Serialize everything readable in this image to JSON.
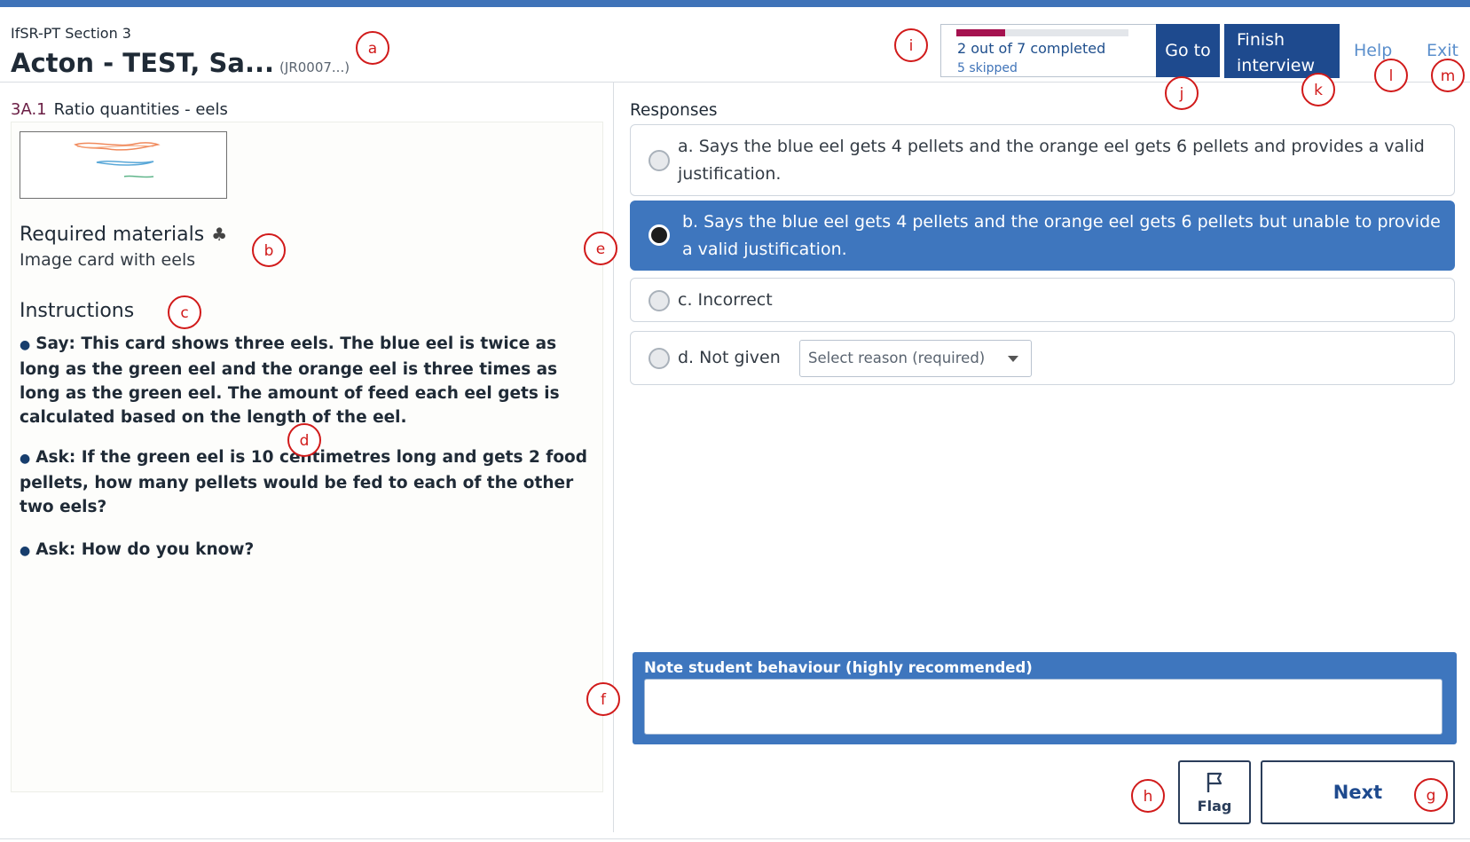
{
  "header": {
    "section_title": "IfSR-PT Section 3",
    "student_name": "Acton - TEST, Sa...",
    "student_id": "(JR0007...)"
  },
  "progress": {
    "completed_text": "2 out of 7 completed",
    "skipped_text": "5 skipped",
    "completed": 2,
    "total": 7,
    "fill_color": "#a5124f"
  },
  "toolbar": {
    "goto_label": "Go to",
    "finish_label": "Finish interview",
    "help_label": "Help",
    "exit_label": "Exit"
  },
  "question": {
    "number": "3A.1",
    "title": "Ratio quantities - eels",
    "required_heading": "Required materials",
    "required_icon": "shapes-icon",
    "required_text": "Image card with eels",
    "instructions_heading": "Instructions",
    "instructions": [
      "Say: This card shows three eels. The blue eel is twice as long as the green eel and the orange eel is three times as long as the green eel. The amount of feed each eel gets is calculated based on the length of the eel.",
      "Ask: If the green eel is 10 centimetres long and gets 2 food pellets, how many pellets would be fed to each of the other two eels?",
      "Ask: How do you know?"
    ]
  },
  "responses": {
    "heading": "Responses",
    "options": [
      {
        "label": "a. Says the blue eel gets 4 pellets and the orange eel gets 6 pellets and provides a valid justification.",
        "selected": false
      },
      {
        "label": "b. Says the blue eel gets 4 pellets and the orange eel gets 6 pellets but unable to provide a valid justification.",
        "selected": true
      },
      {
        "label": "c. Incorrect",
        "selected": false
      },
      {
        "label": "d. Not given",
        "selected": false
      }
    ],
    "reason_placeholder": "Select reason (required)"
  },
  "note": {
    "label": "Note student behaviour (highly recommended)",
    "value": ""
  },
  "footer": {
    "flag_label": "Flag",
    "next_label": "Next"
  },
  "markers": [
    "a",
    "b",
    "c",
    "d",
    "e",
    "f",
    "g",
    "h",
    "i",
    "j",
    "k",
    "l",
    "m"
  ],
  "colors": {
    "accent": "#1e4a8e",
    "selected": "#3e76be",
    "marker": "#d11a1a"
  }
}
